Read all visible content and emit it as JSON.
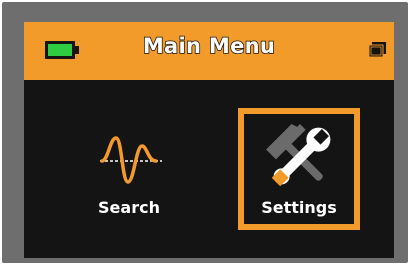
{
  "header": {
    "title": "Main Menu",
    "battery_icon": "battery-full-icon",
    "storage_icon": "sd-card-icon"
  },
  "menu": {
    "items": [
      {
        "label": "Search",
        "icon": "waveform-icon",
        "selected": false
      },
      {
        "label": "Settings",
        "icon": "wrench-hammer-icon",
        "selected": true
      }
    ]
  },
  "colors": {
    "accent": "#f29a2a",
    "screen_background": "#141414",
    "bezel": "#6e6e6e",
    "battery_fill": "#2ecc40",
    "text": "#ffffff"
  }
}
